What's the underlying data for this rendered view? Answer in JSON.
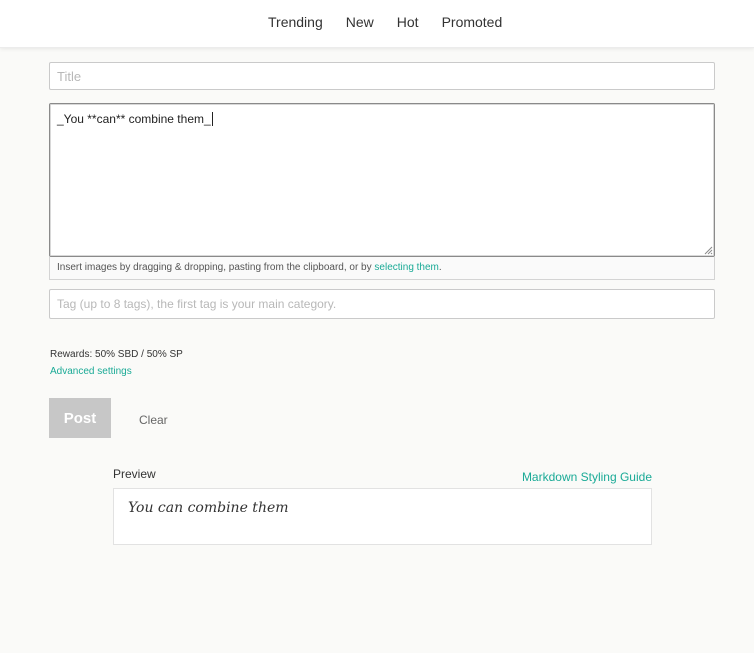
{
  "nav": {
    "items": [
      {
        "label": "Trending"
      },
      {
        "label": "New"
      },
      {
        "label": "Hot"
      },
      {
        "label": "Promoted"
      }
    ]
  },
  "editor": {
    "title_placeholder": "Title",
    "title_value": "",
    "body_value": "_You **can** combine them_",
    "upload_hint_prefix": "Insert images by dragging & dropping, pasting from the clipboard, or by ",
    "upload_hint_link": "selecting them",
    "upload_hint_suffix": ".",
    "tags_placeholder": "Tag (up to 8 tags), the first tag is your main category.",
    "tags_value": ""
  },
  "settings": {
    "rewards": "Rewards: 50% SBD / 50% SP",
    "advanced_label": "Advanced settings"
  },
  "actions": {
    "post_label": "Post",
    "clear_label": "Clear"
  },
  "preview": {
    "label": "Preview",
    "guide_label": "Markdown Styling Guide",
    "rendered_text": "You can combine them"
  },
  "colors": {
    "accent": "#1aaa96",
    "post_disabled": "#c7c7c7",
    "background": "#fafaf8"
  }
}
